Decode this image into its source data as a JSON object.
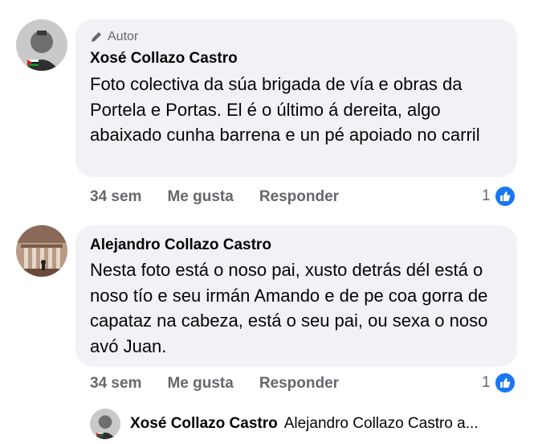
{
  "comments": [
    {
      "author_tag": "Autor",
      "name": "Xosé Collazo Castro",
      "text": "Foto colectiva da súa brigada de vía e obras da Portela e Portas. El é o último á dereita, algo abaixado cunha barrena e un pé apoiado no carril",
      "time": "34 sem",
      "like_label": "Me gusta",
      "reply_label": "Responder",
      "reactions": "1"
    },
    {
      "name": "Alejandro Collazo Castro",
      "text": "Nesta foto está o noso pai, xusto detrás dél está o noso tío e seu irmán Amando e de pe coa gorra de capataz na cabeza, está o seu pai, ou sexa o noso avó Juan.",
      "time": "34 sem",
      "like_label": "Me gusta",
      "reply_label": "Responder",
      "reactions": "1"
    }
  ],
  "reply_preview": {
    "name": "Xosé Collazo Castro",
    "text": "Alejandro Collazo Castro a..."
  },
  "colors": {
    "bubble": "#f0f2f5",
    "secondary_text": "#65676b",
    "like_blue": "#1877f2"
  },
  "icons": [
    "pencil-icon",
    "like-icon",
    "avatar-xose",
    "avatar-alejandro"
  ]
}
